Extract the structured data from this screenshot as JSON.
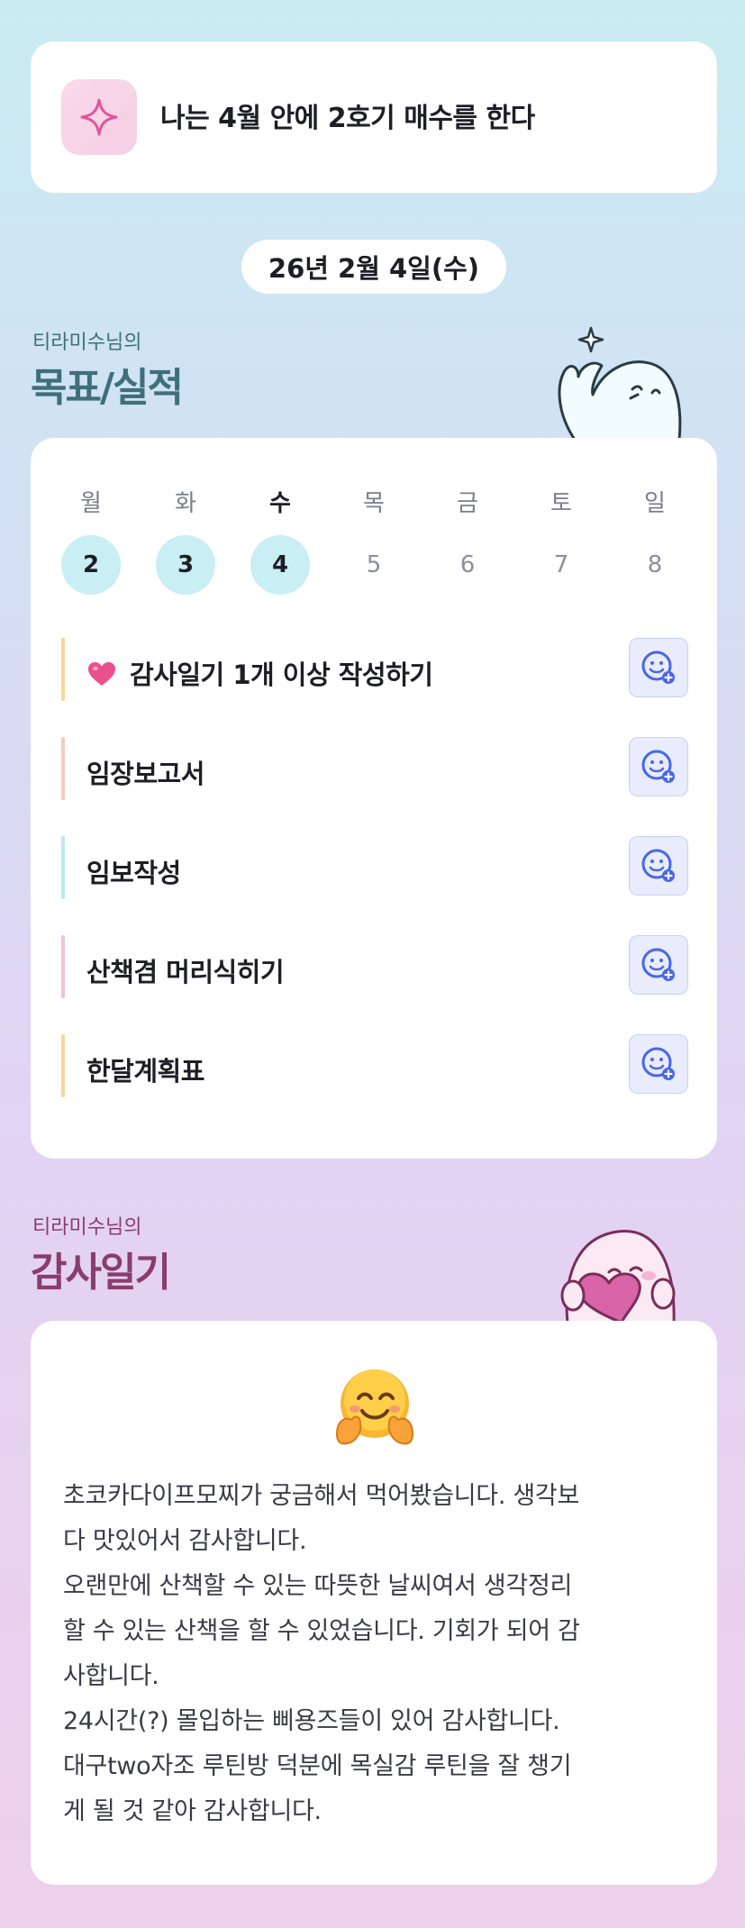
{
  "goal": {
    "text": "나는 4월 안에 2호기 매수를 한다",
    "icon": "sparkle-icon"
  },
  "date_label": "26년 2월 4일(수)",
  "goals_section": {
    "subtitle": "티라미수님의",
    "title": "목표/실적",
    "title_color": "#3e6f7a"
  },
  "week": {
    "days": [
      "월",
      "화",
      "수",
      "목",
      "금",
      "토",
      "일"
    ],
    "dates": [
      "2",
      "3",
      "4",
      "5",
      "6",
      "7",
      "8"
    ],
    "today_index": 2
  },
  "tasks": [
    {
      "label": "감사일기 1개 이상 작성하기",
      "icon": "heart-icon",
      "bar_color": "#f6d79a"
    },
    {
      "label": "임장보고서",
      "bar_color": "#f3cdb9"
    },
    {
      "label": "임보작성",
      "bar_color": "#bfe6f1"
    },
    {
      "label": "산책겸 머리식히기",
      "bar_color": "#f0c3dd"
    },
    {
      "label": "한달계획표",
      "bar_color": "#f6d79a"
    }
  ],
  "task_action_icon": "smile-add-icon",
  "diary_section": {
    "subtitle": "티라미수님의",
    "title": "감사일기",
    "title_color": "#8a3d6b"
  },
  "diary": {
    "emoji": "hugging-face-icon",
    "text": "초코카다이프모찌가 궁금해서 먹어봤습니다. 생각보\n다 맛있어서 감사합니다.\n오랜만에 산책할 수 있는 따뜻한 날씨여서 생각정리\n할 수 있는 산책을 할 수 있었습니다. 기회가 되어 감\n사합니다.\n24시간(?) 몰입하는 삐용즈들이 있어 감사합니다.\n대구two자조 루틴방 덕분에 목실감 루틴을 잘 챙기\n게 될 것 같아 감사합니다."
  },
  "colors": {
    "accent": "#4a66e8",
    "active_day": "#c9eef4",
    "card": "#ffffff"
  }
}
